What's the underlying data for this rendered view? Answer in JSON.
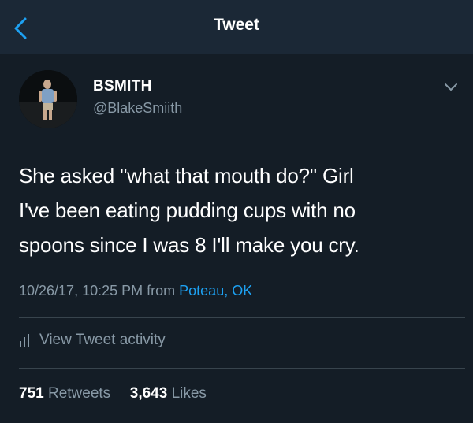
{
  "header": {
    "title": "Tweet",
    "back_icon": "chevron-left-icon"
  },
  "author": {
    "display_name": "BSMITH",
    "handle": "@BlakeSmiith",
    "menu_icon": "chevron-down-icon"
  },
  "tweet": {
    "lines": [
      "She asked \"what that mouth do?\" Girl",
      "I've been eating pudding cups with no",
      "spoons since I was 8 I'll make you cry."
    ],
    "timestamp": "10/26/17, 10:25 PM",
    "from_label": "from",
    "location": "Poteau, OK"
  },
  "activity": {
    "label": "View Tweet activity",
    "icon": "bar-chart-icon"
  },
  "stats": {
    "retweets_count": "751",
    "retweets_label": "Retweets",
    "likes_count": "3,643",
    "likes_label": "Likes"
  },
  "colors": {
    "background": "#141d26",
    "navbar": "#1b2836",
    "secondary_text": "#8899a6",
    "link": "#1da1f2",
    "back_arrow": "#1da1f2"
  }
}
